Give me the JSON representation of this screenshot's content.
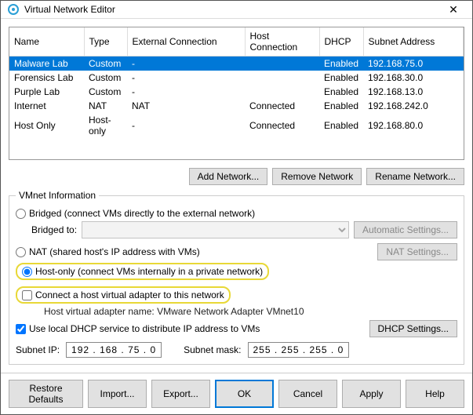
{
  "window": {
    "title": "Virtual Network Editor"
  },
  "columns": [
    "Name",
    "Type",
    "External Connection",
    "Host Connection",
    "DHCP",
    "Subnet Address"
  ],
  "rows": [
    {
      "name": "Malware Lab",
      "type": "Custom",
      "ext": "-",
      "host": "",
      "dhcp": "Enabled",
      "subnet": "192.168.75.0",
      "selected": true
    },
    {
      "name": "Forensics Lab",
      "type": "Custom",
      "ext": "-",
      "host": "",
      "dhcp": "Enabled",
      "subnet": "192.168.30.0"
    },
    {
      "name": "Purple Lab",
      "type": "Custom",
      "ext": "-",
      "host": "",
      "dhcp": "Enabled",
      "subnet": "192.168.13.0"
    },
    {
      "name": "Internet",
      "type": "NAT",
      "ext": "NAT",
      "host": "Connected",
      "dhcp": "Enabled",
      "subnet": "192.168.242.0"
    },
    {
      "name": "Host Only",
      "type": "Host-only",
      "ext": "-",
      "host": "Connected",
      "dhcp": "Enabled",
      "subnet": "192.168.80.0"
    }
  ],
  "buttons": {
    "add": "Add Network...",
    "remove": "Remove Network",
    "rename": "Rename Network...",
    "auto": "Automatic Settings...",
    "nat": "NAT Settings...",
    "dhcp": "DHCP Settings...",
    "restore": "Restore Defaults",
    "import": "Import...",
    "export": "Export...",
    "ok": "OK",
    "cancel": "Cancel",
    "apply": "Apply",
    "help": "Help"
  },
  "info": {
    "legend": "VMnet Information",
    "bridged": "Bridged (connect VMs directly to the external network)",
    "bridged_to": "Bridged to:",
    "nat": "NAT (shared host's IP address with VMs)",
    "hostonly": "Host-only (connect VMs internally in a private network)",
    "connect_adapter": "Connect a host virtual adapter to this network",
    "adapter_name": "Host virtual adapter name: VMware Network Adapter VMnet10",
    "use_dhcp": "Use local DHCP service to distribute IP address to VMs",
    "subnet_ip_label": "Subnet IP:",
    "subnet_ip": "192 . 168 . 75 . 0",
    "subnet_mask_label": "Subnet mask:",
    "subnet_mask": "255 . 255 . 255 . 0"
  }
}
